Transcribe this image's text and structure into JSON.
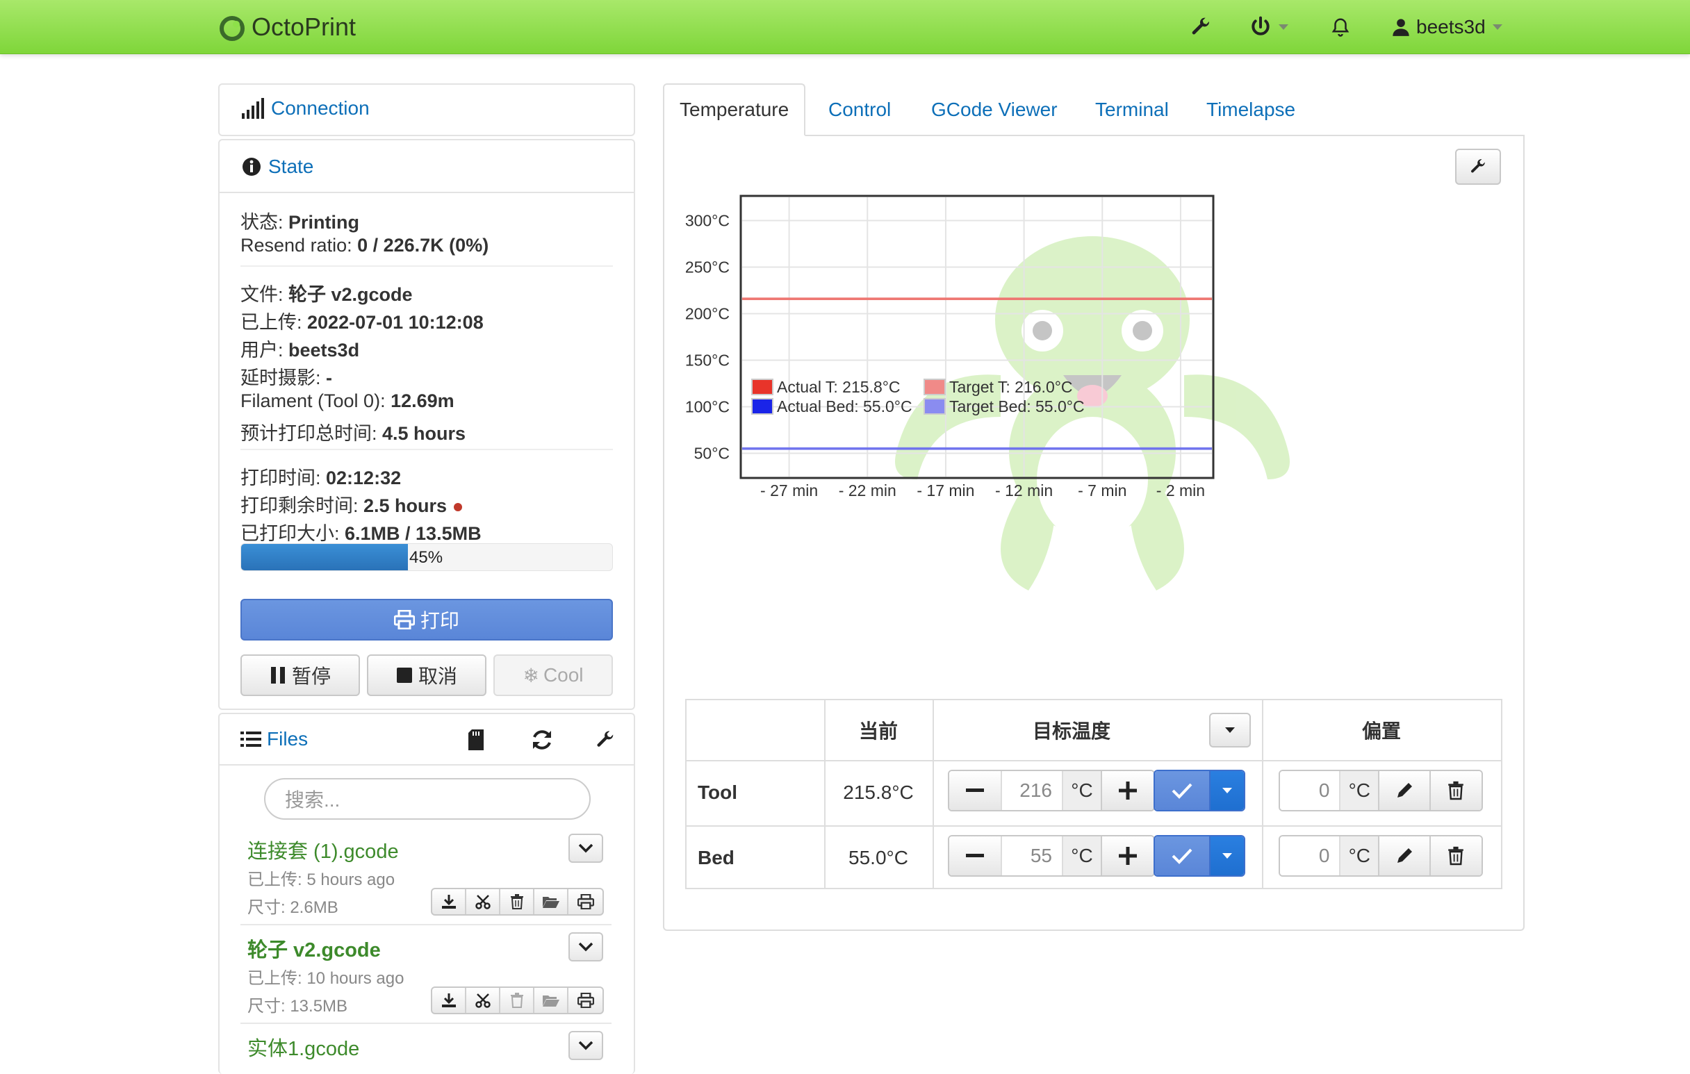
{
  "navbar": {
    "brand": "OctoPrint",
    "user": "beets3d",
    "icons": [
      "wrench-icon",
      "power-icon",
      "bell-icon",
      "user-icon"
    ]
  },
  "connection": {
    "title": "Connection"
  },
  "state": {
    "title": "State",
    "status_label": "状态: ",
    "status_value": "Printing",
    "resend_label": "Resend ratio: ",
    "resend_value": "0 / 226.7K (0%)",
    "file_label": "文件: ",
    "file_value": "轮子 v2.gcode",
    "uploaded_label": "已上传: ",
    "uploaded_value": "2022-07-01 10:12:08",
    "user_label": "用户: ",
    "user_value": "beets3d",
    "timelapse_label": "延时摄影: ",
    "timelapse_value": "-",
    "filament_label": "Filament (Tool 0): ",
    "filament_value": "12.69m",
    "est_label": "预计打印总时间: ",
    "est_value": "4.5 hours",
    "print_time_label": "打印时间: ",
    "print_time_value": "02:12:32",
    "remaining_label": "打印剩余时间: ",
    "remaining_value": "2.5 hours",
    "printed_label": "已打印大小: ",
    "printed_value": "6.1MB / 13.5MB",
    "progress_percent": 45,
    "progress_text": "45%",
    "print_button": "打印",
    "pause_button": "暂停",
    "cancel_button": "取消",
    "cool_button": "Cool"
  },
  "files": {
    "title": "Files",
    "search_placeholder": "搜索...",
    "items": [
      {
        "name": "连接套 (1).gcode",
        "uploaded": "已上传: 5 hours ago",
        "size": "尺寸: 2.6MB"
      },
      {
        "name": "轮子 v2.gcode",
        "uploaded": "已上传: 10 hours ago",
        "size": "尺寸: 13.5MB"
      },
      {
        "name": "实体1.gcode"
      }
    ]
  },
  "tabs": [
    "Temperature",
    "Control",
    "GCode Viewer",
    "Terminal",
    "Timelapse"
  ],
  "chart_data": {
    "type": "line",
    "x": [
      "- 27 min",
      "- 22 min",
      "- 17 min",
      "- 12 min",
      "- 7 min",
      "- 2 min"
    ],
    "ylim": [
      25,
      325
    ],
    "yticks": [
      "300°C",
      "250°C",
      "200°C",
      "150°C",
      "100°C",
      "50°C"
    ],
    "ytick_values": [
      300,
      250,
      200,
      150,
      100,
      50
    ],
    "series": [
      {
        "name": "Actual T: 215.8°C",
        "color": "#e8342a",
        "values": [
          215.8,
          215.8,
          215.8,
          215.8,
          215.8,
          215.8
        ]
      },
      {
        "name": "Target T: 216.0°C",
        "color": "#f08a88",
        "values": [
          216,
          216,
          216,
          216,
          216,
          216
        ]
      },
      {
        "name": "Actual Bed: 55.0°C",
        "color": "#1a24e8",
        "values": [
          55,
          55,
          55,
          55,
          55,
          55
        ]
      },
      {
        "name": "Target Bed: 55.0°C",
        "color": "#8a8cf0",
        "values": [
          55,
          55,
          55,
          55,
          55,
          55
        ]
      }
    ],
    "grid": true,
    "legend": "bottom-left"
  },
  "temp_table": {
    "col_current": "当前",
    "col_target": "目标温度",
    "col_offset": "偏置",
    "rows": [
      {
        "name": "Tool",
        "current": "215.8°C",
        "target": "216",
        "unit": "°C",
        "offset": "0"
      },
      {
        "name": "Bed",
        "current": "55.0°C",
        "target": "55",
        "unit": "°C",
        "offset": "0"
      }
    ]
  },
  "colors": {
    "navbar": "#8ee04a",
    "link": "#0d6fb8",
    "primary": "#5a86d8",
    "file_green": "#3d8a2b",
    "remaining_dot": "#c0392b"
  }
}
